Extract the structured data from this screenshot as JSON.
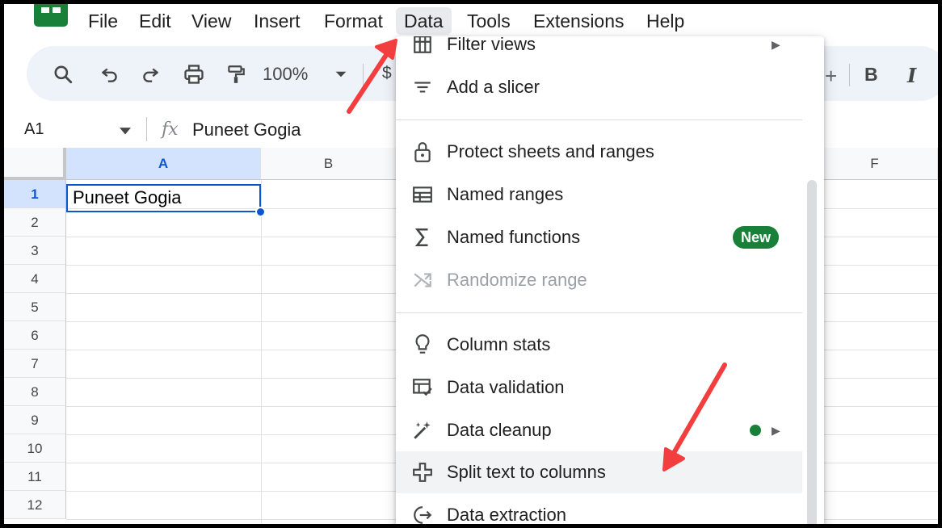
{
  "menubar": {
    "items": [
      "File",
      "Edit",
      "View",
      "Insert",
      "Format",
      "Data",
      "Tools",
      "Extensions",
      "Help"
    ],
    "active": "Data"
  },
  "toolbar": {
    "zoom": "100%",
    "currency_symbol": "$",
    "bold": "B",
    "italic": "I",
    "icons": [
      "search-icon",
      "undo-icon",
      "redo-icon",
      "print-icon",
      "paint-format-icon"
    ]
  },
  "formula_bar": {
    "cell_ref": "A1",
    "fx": "fx",
    "value": "Puneet Gogia"
  },
  "grid": {
    "columns": [
      "A",
      "B",
      "F"
    ],
    "rows": [
      "1",
      "2",
      "3",
      "4",
      "5",
      "6",
      "7",
      "8",
      "9",
      "10",
      "11",
      "12"
    ],
    "a1_value": "Puneet Gogia"
  },
  "data_menu": {
    "items": [
      {
        "label": "Filter views",
        "icon": "filter-views-icon"
      },
      {
        "label": "Add a slicer",
        "icon": "slicer-icon"
      },
      {
        "label": "Protect sheets and ranges",
        "icon": "lock-icon"
      },
      {
        "label": "Named ranges",
        "icon": "named-ranges-icon"
      },
      {
        "label": "Named functions",
        "icon": "sigma-icon",
        "badge": "New"
      },
      {
        "label": "Randomize range",
        "icon": "shuffle-icon",
        "disabled": true
      },
      {
        "label": "Column stats",
        "icon": "lightbulb-icon"
      },
      {
        "label": "Data validation",
        "icon": "data-validation-icon"
      },
      {
        "label": "Data cleanup",
        "icon": "magic-wand-icon"
      },
      {
        "label": "Split text to columns",
        "icon": "split-columns-icon",
        "highlighted": true
      },
      {
        "label": "Data extraction",
        "icon": "data-extraction-icon"
      }
    ]
  },
  "colors": {
    "accent": "#0b57d0",
    "brand_green": "#188038",
    "annotation_red": "#f23e3e"
  }
}
